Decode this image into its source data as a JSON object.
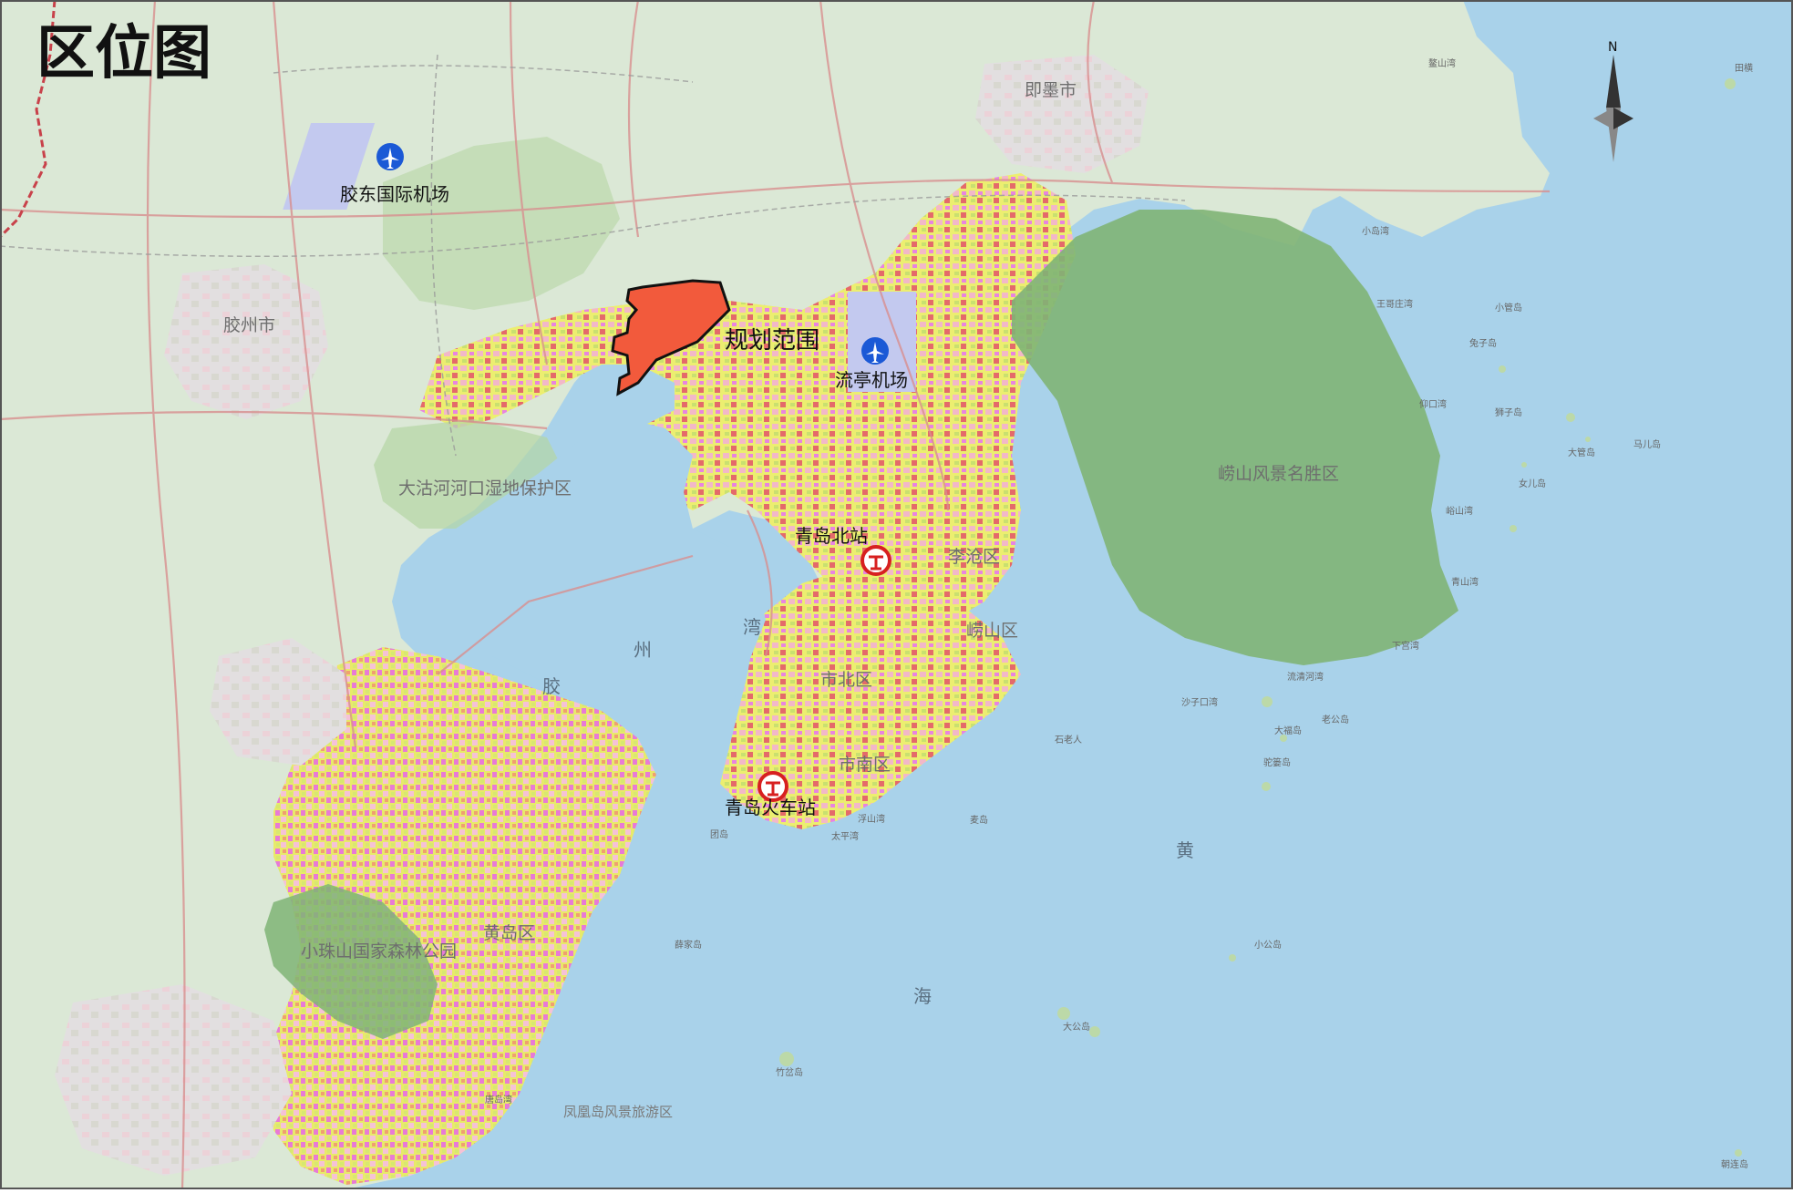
{
  "title": "区位图",
  "colors": {
    "sea": "#a9d2ea",
    "land": "#dbe8d6",
    "plan_area": "#f25a3c",
    "airport_icon": "#1b59d6",
    "station_icon": "#d72020",
    "mountain": "#7fb476"
  },
  "north_arrow": "N",
  "airports": [
    {
      "name": "胶东国际机场",
      "icon": "airplane-icon"
    },
    {
      "name": "流亭机场",
      "icon": "airplane-icon"
    }
  ],
  "stations": [
    {
      "name": "青岛北站",
      "icon": "railway-station-icon"
    },
    {
      "name": "青岛火车站",
      "icon": "railway-station-icon"
    }
  ],
  "plan_label": "规划范围",
  "cities": [
    "即墨市",
    "胶州市",
    "黄岛区",
    "李沧区",
    "崂山区",
    "市北区",
    "市南区"
  ],
  "areas": [
    "崂山风景名胜区",
    "大沽河河口湿地保护区",
    "小珠山国家森林公园",
    "凤凰岛风景旅游区"
  ],
  "sea_labels": [
    "胶",
    "州",
    "湾",
    "黄",
    "海"
  ],
  "islands": [
    "小岛湾",
    "王哥庄湾",
    "小管岛",
    "兔子岛",
    "仰口湾",
    "狮子岛",
    "大管岛",
    "马儿岛",
    "女儿岛",
    "峪山湾",
    "青山湾",
    "下宫湾",
    "流清河湾",
    "沙子口湾",
    "大福岛",
    "老公岛",
    "驼篓岛",
    "石老人",
    "浮山湾",
    "太平湾",
    "麦岛",
    "团岛",
    "小公岛",
    "大公岛",
    "竹岔岛",
    "薛家岛",
    "唐岛湾",
    "朝连岛",
    "田横",
    "鳌山湾"
  ]
}
